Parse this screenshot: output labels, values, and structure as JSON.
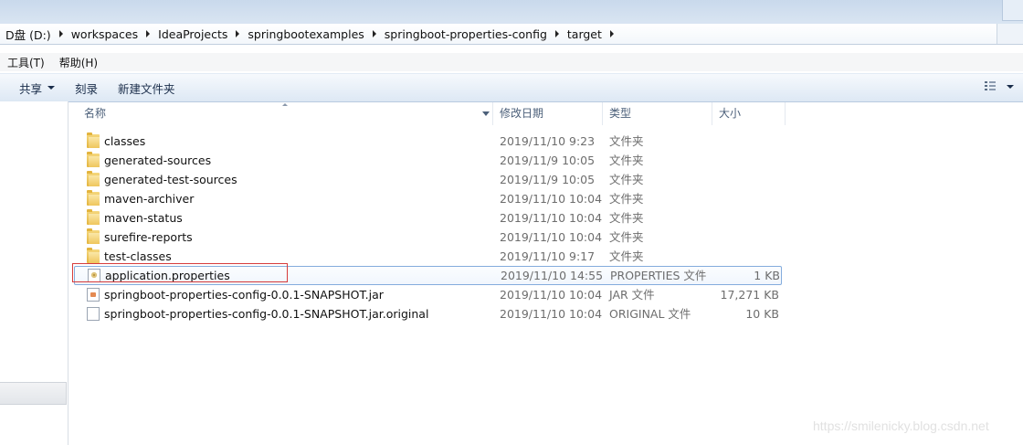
{
  "address": {
    "crumbs": [
      "D盘 (D:)",
      "workspaces",
      "IdeaProjects",
      "springbootexamples",
      "springboot-properties-config",
      "target"
    ]
  },
  "menubar": {
    "items": [
      "工具(T)",
      "帮助(H)"
    ]
  },
  "toolbar": {
    "share_label": "共享",
    "burn_label": "刻录",
    "new_folder_label": "新建文件夹"
  },
  "columns": {
    "name": "名称",
    "date": "修改日期",
    "type": "类型",
    "size": "大小"
  },
  "files": [
    {
      "name": "classes",
      "date": "2019/11/10 9:23",
      "type": "文件夹",
      "size": "",
      "icon": "folder-icon"
    },
    {
      "name": "generated-sources",
      "date": "2019/11/9 10:05",
      "type": "文件夹",
      "size": "",
      "icon": "folder-icon"
    },
    {
      "name": "generated-test-sources",
      "date": "2019/11/9 10:05",
      "type": "文件夹",
      "size": "",
      "icon": "folder-icon"
    },
    {
      "name": "maven-archiver",
      "date": "2019/11/10 10:04",
      "type": "文件夹",
      "size": "",
      "icon": "folder-icon"
    },
    {
      "name": "maven-status",
      "date": "2019/11/10 10:04",
      "type": "文件夹",
      "size": "",
      "icon": "folder-icon"
    },
    {
      "name": "surefire-reports",
      "date": "2019/11/10 10:04",
      "type": "文件夹",
      "size": "",
      "icon": "folder-icon"
    },
    {
      "name": "test-classes",
      "date": "2019/11/10 9:17",
      "type": "文件夹",
      "size": "",
      "icon": "folder-icon"
    },
    {
      "name": "application.properties",
      "date": "2019/11/10 14:55",
      "type": "PROPERTIES 文件",
      "size": "1 KB",
      "icon": "properties-file-icon",
      "selected": true
    },
    {
      "name": "springboot-properties-config-0.0.1-SNAPSHOT.jar",
      "date": "2019/11/10 10:04",
      "type": "JAR 文件",
      "size": "17,271 KB",
      "icon": "jar-file-icon"
    },
    {
      "name": "springboot-properties-config-0.0.1-SNAPSHOT.jar.original",
      "date": "2019/11/10 10:04",
      "type": "ORIGINAL 文件",
      "size": "10 KB",
      "icon": "file-icon"
    }
  ],
  "watermark": "https://smilenicky.blog.csdn.net",
  "colors": {
    "highlight": "#d63b3b",
    "selection_border": "#84acdd",
    "folder": "#e3b43e"
  }
}
